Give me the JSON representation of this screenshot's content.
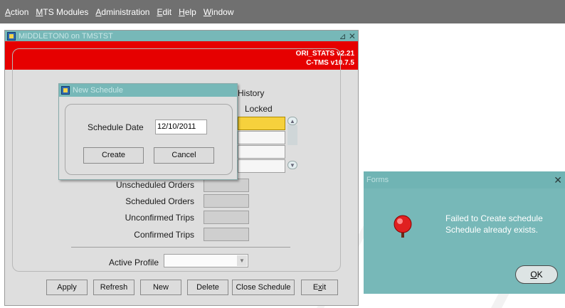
{
  "menubar": {
    "items": [
      {
        "label": "Action",
        "accel": "A"
      },
      {
        "label": "MTS Modules",
        "accel": "M"
      },
      {
        "label": "Administration",
        "accel": "A"
      },
      {
        "label": "Edit",
        "accel": "E"
      },
      {
        "label": "Help",
        "accel": "H"
      },
      {
        "label": "Window",
        "accel": "W"
      }
    ]
  },
  "main_window": {
    "title": "MIDDLETON0 on TMSTST",
    "controls": "⊿ ✕",
    "banner_line1": "ORI_STATS v2.21",
    "banner_line2": "C-TMS v10.7.5",
    "history_label": "History",
    "locked_label": "Locked",
    "fields": [
      {
        "label": "Unscheduled Orders",
        "value": ""
      },
      {
        "label": "Scheduled Orders",
        "value": ""
      },
      {
        "label": "Unconfirmed Trips",
        "value": ""
      },
      {
        "label": "Confirmed Trips",
        "value": ""
      }
    ],
    "active_profile_label": "Active Profile",
    "active_profile_value": "",
    "buttons": [
      {
        "label": "Apply"
      },
      {
        "label": "Refresh"
      },
      {
        "label": "New"
      },
      {
        "label": "Delete"
      },
      {
        "label": "Close Schedule"
      },
      {
        "label": "Exit",
        "pre": "E",
        "accel": "x",
        "post": "it"
      }
    ]
  },
  "new_schedule_dialog": {
    "title": "New Schedule",
    "schedule_date_label": "Schedule Date",
    "schedule_date_value": "12/10/2011",
    "create_label": "Create",
    "cancel_label": "Cancel"
  },
  "forms_alert": {
    "title": "Forms",
    "message_line1": "Failed to Create schedule",
    "message_line2": "Schedule already exists.",
    "ok_accel": "O",
    "ok_rest": "K",
    "icon": "stop-alarm-icon"
  },
  "colors": {
    "menubar": "#707070",
    "title_bar": "#77b8b8",
    "banner": "#e60000",
    "selected_field": "#f6d13c",
    "alert_bg": "#77b8b8"
  }
}
